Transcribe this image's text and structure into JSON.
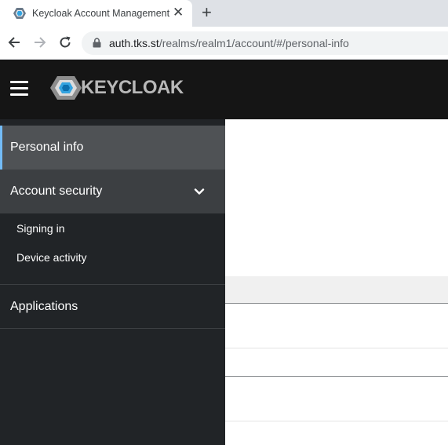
{
  "browser": {
    "tab_title": "Keycloak Account Management",
    "close_glyph": "✕",
    "new_tab_glyph": "+",
    "url_host": "auth.tks.st",
    "url_path": "/realms/realm1/account/#/personal-info"
  },
  "header": {
    "logo_text": "KEYCLOAK"
  },
  "sidebar": {
    "items": [
      {
        "label": "Personal info",
        "active": true
      },
      {
        "label": "Account security",
        "expanded": true,
        "children": [
          {
            "label": "Signing in"
          },
          {
            "label": "Device activity"
          }
        ]
      },
      {
        "label": "Applications"
      }
    ]
  },
  "colors": {
    "header_bg": "#151515",
    "sidebar_bg": "#212427",
    "active_item_bg": "#4f5255",
    "active_accent": "#73bcf7",
    "expanded_item_bg": "#3c3f42"
  }
}
